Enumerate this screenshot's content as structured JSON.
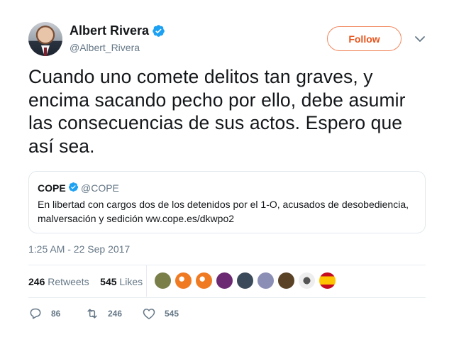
{
  "author": {
    "name": "Albert Rivera",
    "handle": "@Albert_Rivera",
    "verified": true
  },
  "follow_button": {
    "label": "Follow",
    "color": "#e8551d"
  },
  "tweet": {
    "text": "Cuando uno comete delitos tan graves, y encima sacando pecho por ello, debe asumir las consecuencias de sus actos. Espero que así sea."
  },
  "quoted_tweet": {
    "name": "COPE",
    "handle": "@COPE",
    "verified": true,
    "text": "En libertad con cargos dos de los detenidos por el 1-O, acusados de desobediencia, malversación y sedición ww.cope.es/dkwpo2"
  },
  "timestamp": "1:25 AM - 22 Sep 2017",
  "stats": {
    "retweets_count": "246",
    "retweets_label": "Retweets",
    "likes_count": "545",
    "likes_label": "Likes"
  },
  "likers": [
    {
      "name": "liker-1",
      "color": "#7a7f4a"
    },
    {
      "name": "liker-2",
      "color": "#f07a22"
    },
    {
      "name": "liker-3",
      "color": "#f07a22"
    },
    {
      "name": "liker-4",
      "color": "#6b2a72"
    },
    {
      "name": "liker-5",
      "color": "#3b4a5a"
    },
    {
      "name": "liker-6",
      "color": "#8c8fb5"
    },
    {
      "name": "liker-7",
      "color": "#5a4226"
    },
    {
      "name": "liker-8",
      "color": "#d6d6d6"
    },
    {
      "name": "liker-9",
      "color": "#c60b1e"
    }
  ],
  "actions": {
    "reply_count": "86",
    "retweet_count": "246",
    "like_count": "545"
  },
  "colors": {
    "verified": "#1da1f2",
    "text": "#14171a",
    "secondary": "#657786"
  }
}
